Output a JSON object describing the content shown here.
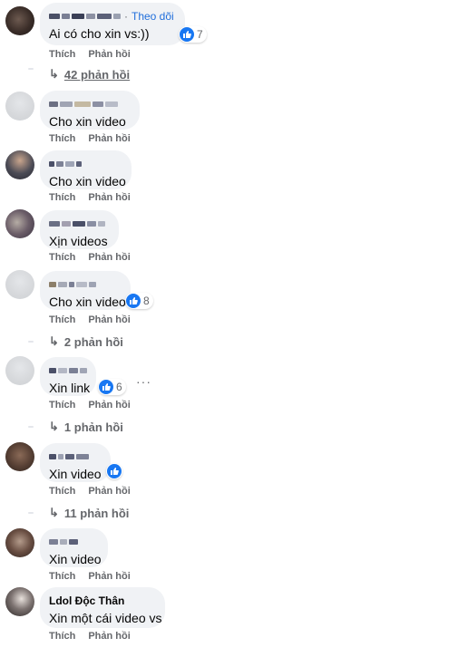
{
  "comments": [
    {
      "author": "",
      "follow_label": "Theo dõi",
      "text": "Ai có cho xin vs:))",
      "like_count": "7",
      "like": "Thích",
      "reply": "Phản hồi"
    },
    {
      "author": "",
      "text": "Cho xin video",
      "like": "Thích",
      "reply": "Phản hồi"
    },
    {
      "author": "",
      "text": "Cho xin video",
      "like": "Thích",
      "reply": "Phản hồi"
    },
    {
      "author": "",
      "text": "Xịn videos",
      "like": "Thích",
      "reply": "Phản hồi"
    },
    {
      "author": "",
      "text": "Cho xin video",
      "like_count": "8",
      "like": "Thích",
      "reply": "Phản hồi"
    },
    {
      "author": "",
      "text": "Xin link",
      "like_count": "6",
      "like": "Thích",
      "reply": "Phản hồi"
    },
    {
      "author": "",
      "text": "Xin video",
      "like": "Thích",
      "reply": "Phản hồi"
    },
    {
      "author": "",
      "text": "Xin video",
      "like": "Thích",
      "reply": "Phản hồi"
    },
    {
      "author": "Ldol Độc Thân",
      "text": "Xin một cái video vs",
      "like": "Thích",
      "reply": "Phản hồi"
    }
  ],
  "reply_links": [
    {
      "label": "42 phản hồi"
    },
    {
      "label": "2 phản hồi"
    },
    {
      "label": "1 phản hồi"
    },
    {
      "label": "11 phản hồi"
    }
  ],
  "icons": {
    "reply_arrow": "↳",
    "like": "thumbs-up-icon",
    "more": "···"
  },
  "colors": {
    "like_blue": "#1877f2",
    "follow_blue": "#216fdb",
    "bubble": "#f0f2f5",
    "meta_gray": "#65676b"
  }
}
